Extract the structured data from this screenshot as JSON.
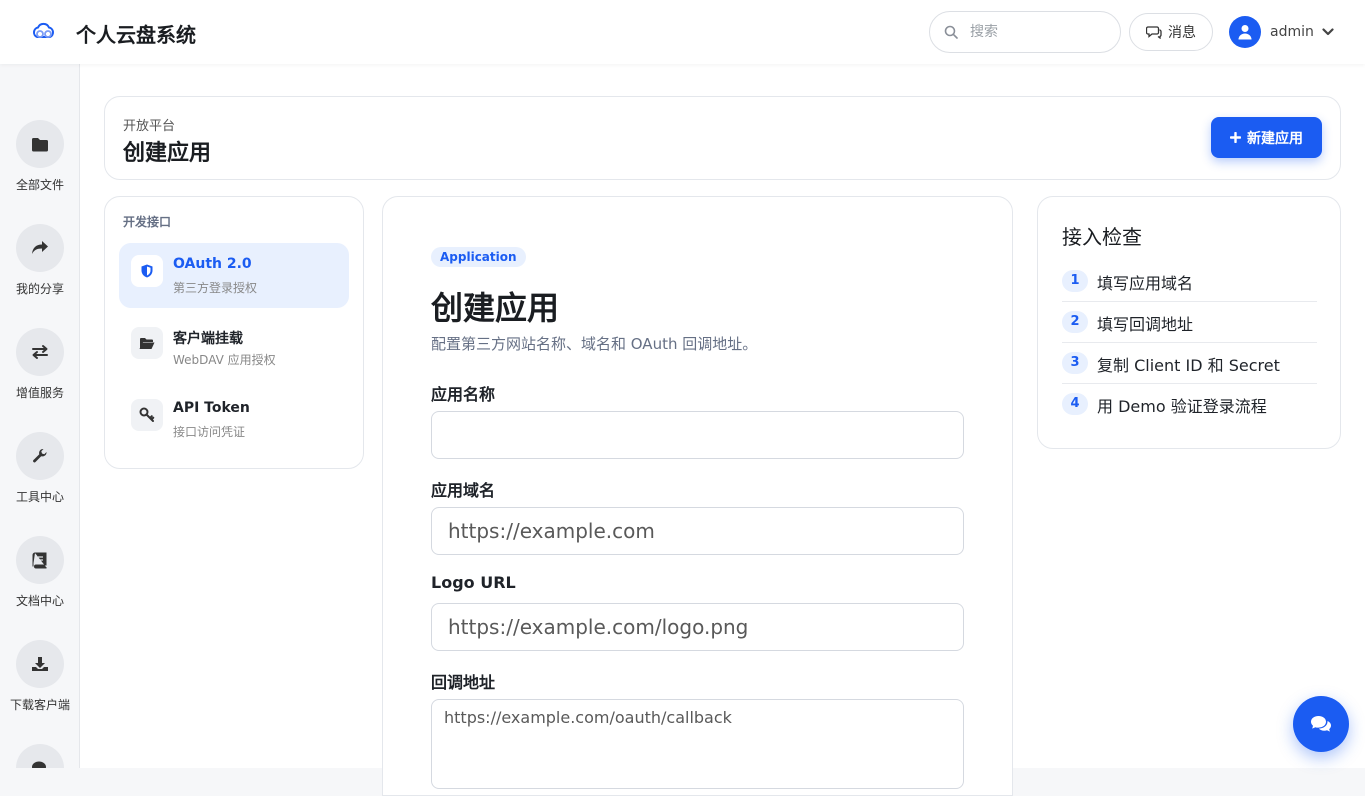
{
  "header": {
    "app_title": "个人云盘系统",
    "search_placeholder": "搜索",
    "messages_label": "消息",
    "username": "admin"
  },
  "rail": {
    "items": [
      {
        "label": "全部文件",
        "icon": "folder-icon"
      },
      {
        "label": "我的分享",
        "icon": "share-icon"
      },
      {
        "label": "增值服务",
        "icon": "exchange-icon"
      },
      {
        "label": "工具中心",
        "icon": "wrench-icon"
      },
      {
        "label": "文档中心",
        "icon": "book-icon"
      },
      {
        "label": "下载客户端",
        "icon": "download-icon"
      }
    ]
  },
  "page": {
    "breadcrumb": "开放平台",
    "title": "创建应用",
    "new_app_button": "新建应用"
  },
  "nav": {
    "heading": "开发接口",
    "items": [
      {
        "title": "OAuth 2.0",
        "subtitle": "第三方登录授权",
        "icon": "shield-icon"
      },
      {
        "title": "客户端挂载",
        "subtitle": "WebDAV 应用授权",
        "icon": "folder-open-icon"
      },
      {
        "title": "API Token",
        "subtitle": "接口访问凭证",
        "icon": "key-icon"
      }
    ]
  },
  "form": {
    "tag": "Application",
    "title": "创建应用",
    "description": "配置第三方网站名称、域名和 OAuth 回调地址。",
    "fields": {
      "name": {
        "label": "应用名称",
        "placeholder": "",
        "value": ""
      },
      "domain": {
        "label": "应用域名",
        "placeholder": "https://example.com"
      },
      "logo": {
        "label": "Logo URL",
        "placeholder": "https://example.com/logo.png"
      },
      "callback": {
        "label": "回调地址",
        "placeholder": "https://example.com/oauth/callback"
      }
    }
  },
  "checklist": {
    "title": "接入检查",
    "items": [
      {
        "num": "1",
        "text": "填写应用域名"
      },
      {
        "num": "2",
        "text": "填写回调地址"
      },
      {
        "num": "3",
        "text": "复制 Client ID 和 Secret"
      },
      {
        "num": "4",
        "text": "用 Demo 验证登录流程"
      }
    ]
  },
  "colors": {
    "accent": "#1b5cf2",
    "accent_light": "#e8f0fe"
  }
}
